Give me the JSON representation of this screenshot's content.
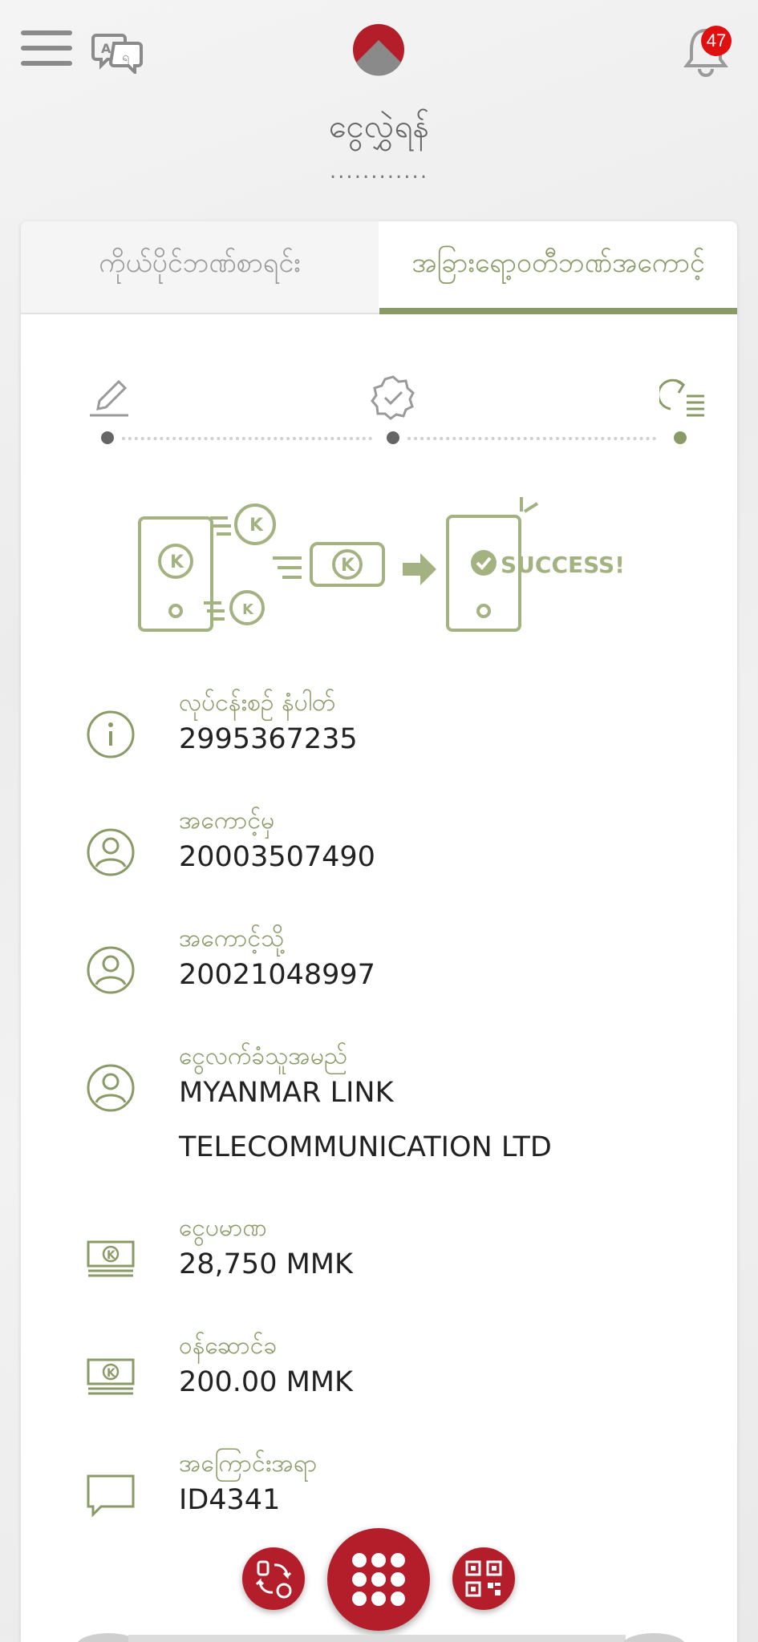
{
  "header": {
    "notification_count": "47",
    "title": "ငွေလွှဲရန်",
    "subtitle_dots": "............",
    "menu_icon": "hamburger-icon",
    "lang_icon": "translate-icon",
    "logo_icon": "bank-logo",
    "bell_icon": "bell-icon"
  },
  "tabs": [
    {
      "label": "ကိုယ်ပိုင်ဘဏ်စာရင်း",
      "active": false
    },
    {
      "label": "အခြားရော့ဝတီဘဏ်အကောင့်",
      "active": true
    }
  ],
  "stepper": {
    "steps": [
      {
        "icon": "pencil-icon",
        "completed": true
      },
      {
        "icon": "verified-badge-icon",
        "completed": true
      },
      {
        "icon": "return-list-icon",
        "completed": true,
        "current": true
      }
    ]
  },
  "illustration": {
    "currency_symbol": "K",
    "success_text": "SUCCESS!"
  },
  "details": [
    {
      "icon": "info-icon",
      "label": "လုပ်ငန်းစဉ် နံပါတ်",
      "value": [
        "2995367235"
      ]
    },
    {
      "icon": "user-icon",
      "label": "အကောင့်မှ",
      "value": [
        "20003507490"
      ]
    },
    {
      "icon": "user-icon",
      "label": "အကောင့်သို့",
      "value": [
        "20021048997"
      ]
    },
    {
      "icon": "user-icon",
      "label": "ငွေလက်ခံသူအမည်",
      "value": [
        "MYANMAR LINK",
        "TELECOMMUNICATION LTD"
      ]
    },
    {
      "icon": "cash-icon",
      "label": "ငွေပမာဏ",
      "value": [
        "28,750 MMK"
      ]
    },
    {
      "icon": "cash-icon",
      "label": "ဝန်ဆောင်ခ",
      "value": [
        "200.00 MMK"
      ]
    },
    {
      "icon": "chat-icon",
      "label": "အကြောင်းအရာ",
      "value": [
        "ID4341"
      ]
    }
  ],
  "colors": {
    "accent": "#8a9a66",
    "brand_red": "#b31e2a",
    "badge_red": "#e01010"
  }
}
